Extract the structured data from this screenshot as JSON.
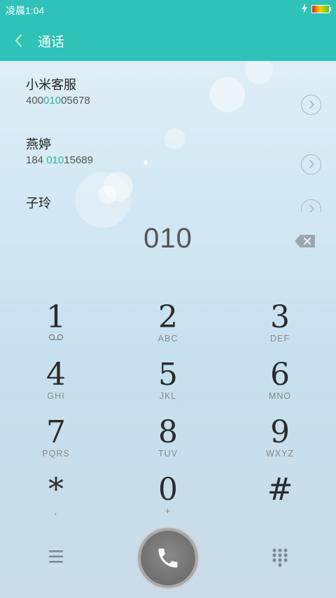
{
  "status_bar": {
    "time": "凌晨1:04"
  },
  "header": {
    "title": "通话"
  },
  "contacts": [
    {
      "name": "小米客服",
      "number_pre": "400",
      "number_match": "010",
      "number_post": "05678"
    },
    {
      "name": "燕婷",
      "number_pre": "184 ",
      "number_match": "010",
      "number_post": "15689"
    },
    {
      "name": "子玲",
      "number_pre": "",
      "number_match": "",
      "number_post": ""
    }
  ],
  "dial_input": {
    "value": "010"
  },
  "keypad": [
    {
      "digit": "1",
      "letters": ""
    },
    {
      "digit": "2",
      "letters": "ABC"
    },
    {
      "digit": "3",
      "letters": "DEF"
    },
    {
      "digit": "4",
      "letters": "GHI"
    },
    {
      "digit": "5",
      "letters": "JKL"
    },
    {
      "digit": "6",
      "letters": "MNO"
    },
    {
      "digit": "7",
      "letters": "PQRS"
    },
    {
      "digit": "8",
      "letters": "TUV"
    },
    {
      "digit": "9",
      "letters": "WXYZ"
    },
    {
      "digit": "*",
      "letters": ","
    },
    {
      "digit": "0",
      "letters": "+"
    },
    {
      "digit": "#",
      "letters": ""
    }
  ],
  "icons": {
    "back": "chevron-left-icon",
    "detail": "chevron-right-icon",
    "backspace": "backspace-icon",
    "voicemail": "voicemail-icon",
    "menu": "menu-icon",
    "call": "phone-icon",
    "keypad": "keypad-icon"
  },
  "colors": {
    "accent": "#2ec2b8",
    "match_highlight": "#2db39a",
    "call_button": "#707070"
  }
}
